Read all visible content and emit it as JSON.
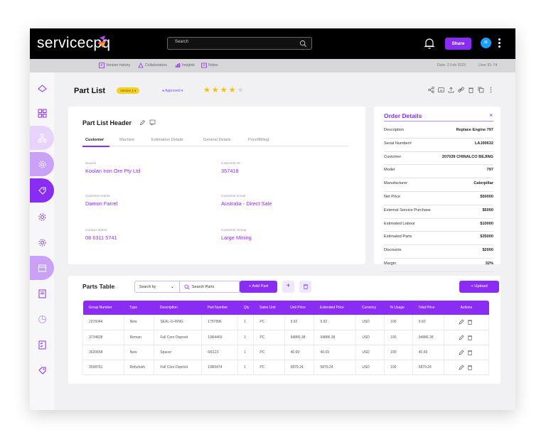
{
  "app": {
    "brand": "servicecpq",
    "search_placeholder": "Search",
    "share_label": "Share",
    "avatar_initial": "M"
  },
  "subbar": {
    "version_history": "Version history",
    "collaborators": "Collaborators",
    "insights": "Insights",
    "notes": "Notes",
    "date": "Date: 2 Feb 2023",
    "user_id": "User ID: 74"
  },
  "page": {
    "title": "Part List",
    "version_badge": "Version 1",
    "status": "Approved",
    "rating": 4,
    "rating_max": 5
  },
  "header_card": {
    "title": "Part List Header",
    "tabs": [
      "Customer",
      "Machine",
      "Estimation Details",
      "General Details",
      "Price/Billing"
    ],
    "fields": [
      {
        "label": "Source",
        "value": "Koolan Iron Ore Pty Ltd"
      },
      {
        "label": "Customer ID",
        "value": "357418"
      },
      {
        "label": "Customer Name",
        "value": "Damon Farrel"
      },
      {
        "label": "Customer Email",
        "value": "Australia - Direct Sale"
      },
      {
        "label": "Contact Name",
        "value": "08 6311 5741"
      },
      {
        "label": "Customer Group",
        "value": "Large Mining"
      }
    ]
  },
  "order_details": {
    "title": "Order Details",
    "rows": [
      {
        "k": "Description",
        "v": "Replace Engine 797"
      },
      {
        "k": "Serial Number#",
        "v": "LAJ00632"
      },
      {
        "k": "Customer",
        "v": "207039 CHINALCO BEJING"
      },
      {
        "k": "Model",
        "v": "797"
      },
      {
        "k": "Manufacturer",
        "v": "Caterpillar"
      },
      {
        "k": "Net Price",
        "v": "$50000"
      },
      {
        "k": "External Service Purchase",
        "v": "$5000"
      },
      {
        "k": "Estimated Labour",
        "v": "$10000"
      },
      {
        "k": "Estimated Parts",
        "v": "$35000"
      },
      {
        "k": "Discounts",
        "v": "$2000"
      },
      {
        "k": "Margin",
        "v": "32%"
      }
    ]
  },
  "parts_table": {
    "title": "Parts Table",
    "search_by": "Search by",
    "search_placeholder": "Search Parts",
    "add_part": "+ Add Part",
    "upload": "+ Upload",
    "columns": [
      "Group Number",
      "Type",
      "Description",
      "Part Number",
      "Qty",
      "Sales Unit",
      "Unit Price",
      "Extended Price",
      "Currency",
      "% Usage",
      "Total Price",
      "Actions"
    ],
    "rows": [
      [
        "2276044",
        "New",
        "SEAL-O-RING",
        "1757896",
        "1",
        "PC",
        "9.92",
        "9.92",
        "USD",
        "100",
        "9.92"
      ],
      [
        "3734828",
        "Reman",
        "Full Core Deposit",
        "10R4469",
        "1",
        "PC",
        "94886.38",
        "94886.38",
        "USD",
        "100",
        "94886.38"
      ],
      [
        "3620658",
        "New",
        "Spacer",
        "6I6123",
        "1",
        "PC",
        "40.69",
        "40.69",
        "USD",
        "100",
        "40.69"
      ],
      [
        "3598761",
        "Refurbish",
        "Full Core Deposit",
        "10R5474",
        "1",
        "PC",
        "5879.24",
        "5879.24",
        "USD",
        "100",
        "5879.24"
      ]
    ]
  },
  "colors": {
    "accent": "#8b2cf5",
    "star": "#f2c200",
    "badge": "#f2d220"
  },
  "icons": [
    "search-icon",
    "bell-icon",
    "kebab-icon",
    "history-icon",
    "collaborators-icon",
    "insights-icon",
    "notes-icon",
    "share-icon",
    "edit-icon",
    "delete-icon",
    "upload-icon"
  ]
}
